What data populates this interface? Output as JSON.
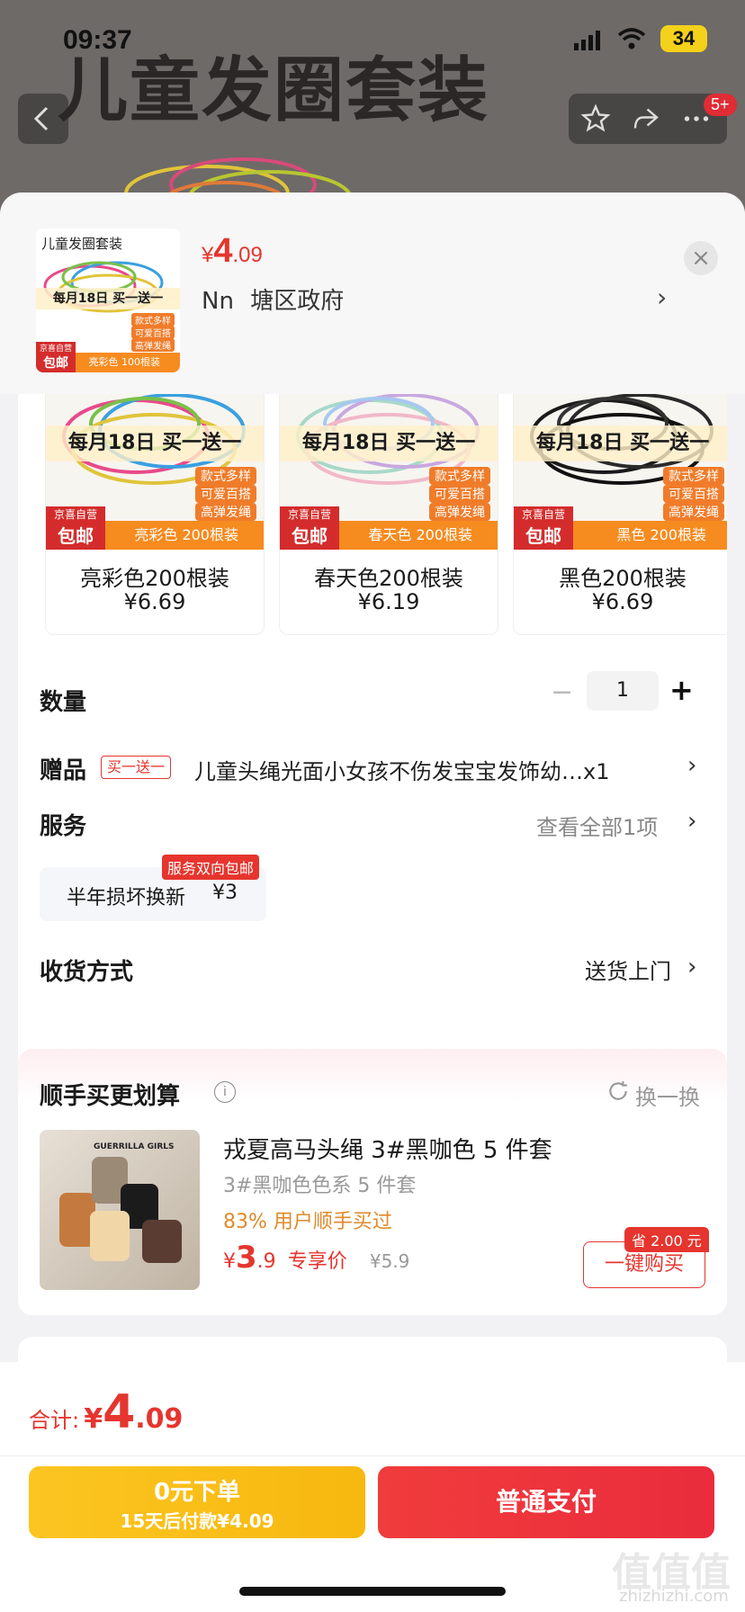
{
  "status": {
    "time": "09:37",
    "battery": "34"
  },
  "background": {
    "title": "儿童发圈套装",
    "badge": "5+"
  },
  "header": {
    "thumb_title": "儿童发圈套装",
    "thumb_promo": "每月18日 买一送一",
    "thumb_tags": [
      "款式多样",
      "可爱百搭",
      "高弹发绳"
    ],
    "thumb_badge_top": "京喜自营",
    "thumb_badge_bottom": "包邮",
    "thumb_strip": "亮彩色 100根装",
    "price_symbol": "¥",
    "price_int": "4",
    "price_dec": ".09",
    "address_name": "Nn",
    "address": "塘区政府",
    "close": "×"
  },
  "options": [
    {
      "name": "亮彩色200根装",
      "price": "¥6.69",
      "promo": "每月18日 买一送一",
      "tags": [
        "款式多样",
        "可爱百搭",
        "高弹发绳"
      ],
      "badge_top": "京喜自营",
      "badge_bottom": "包邮",
      "strip": "亮彩色 200根装"
    },
    {
      "name": "春天色200根装",
      "price": "¥6.19",
      "promo": "每月18日 买一送一",
      "tags": [
        "款式多样",
        "可爱百搭",
        "高弹发绳"
      ],
      "badge_top": "京喜自营",
      "badge_bottom": "包邮",
      "strip": "春天色 200根装"
    },
    {
      "name": "黑色200根装",
      "price": "¥6.69",
      "promo": "每月18日 买一送一",
      "tags": [
        "款式多样",
        "可爱百搭",
        "高弹发绳"
      ],
      "badge_top": "京喜自营",
      "badge_bottom": "包邮",
      "strip": "黑色 200根装"
    }
  ],
  "quantity": {
    "label": "数量",
    "minus": "−",
    "value": "1",
    "plus": "+"
  },
  "gift": {
    "label": "赠品",
    "tag": "买一送一",
    "text": "儿童头绳光面小女孩不伤发宝宝发饰幼…x1",
    "chevron": "›"
  },
  "service": {
    "label": "服务",
    "value": "查看全部1项",
    "chevron": "›",
    "chip_text": "半年损坏换新",
    "chip_price": "¥3",
    "chip_badge": "服务双向包邮"
  },
  "delivery": {
    "label": "收货方式",
    "value": "送货上门",
    "chevron": "›"
  },
  "addon": {
    "title": "顺手买更划算",
    "info_icon": "i",
    "refresh": "换一换",
    "product_title": "戎夏高马头绳 3#黑咖色 5 件套",
    "product_sub": "3#黑咖色色系 5 件套",
    "bought": "83% 用户顺手买过",
    "price_symbol": "¥",
    "price_int": "3",
    "price_dec": ".9",
    "price_label": "专享价",
    "orig_price": "¥5.9",
    "save_badge": "省 2.00 元",
    "buy_button": "一键购买",
    "img_text": "GUERRILLA GIRLS"
  },
  "footer": {
    "total_label": "合计:",
    "total_symbol": "¥",
    "total_int": "4",
    "total_dec": ".09",
    "later_line1": "0元下单",
    "later_line2": "15天后付款¥4.09",
    "pay_button": "普通支付",
    "watermark": "值值值",
    "watermark_sub": "zhizhizhi.com"
  },
  "colors": {
    "accent": "#e5352e",
    "orange": "#f68b1f",
    "yellow": "#fcc521"
  }
}
